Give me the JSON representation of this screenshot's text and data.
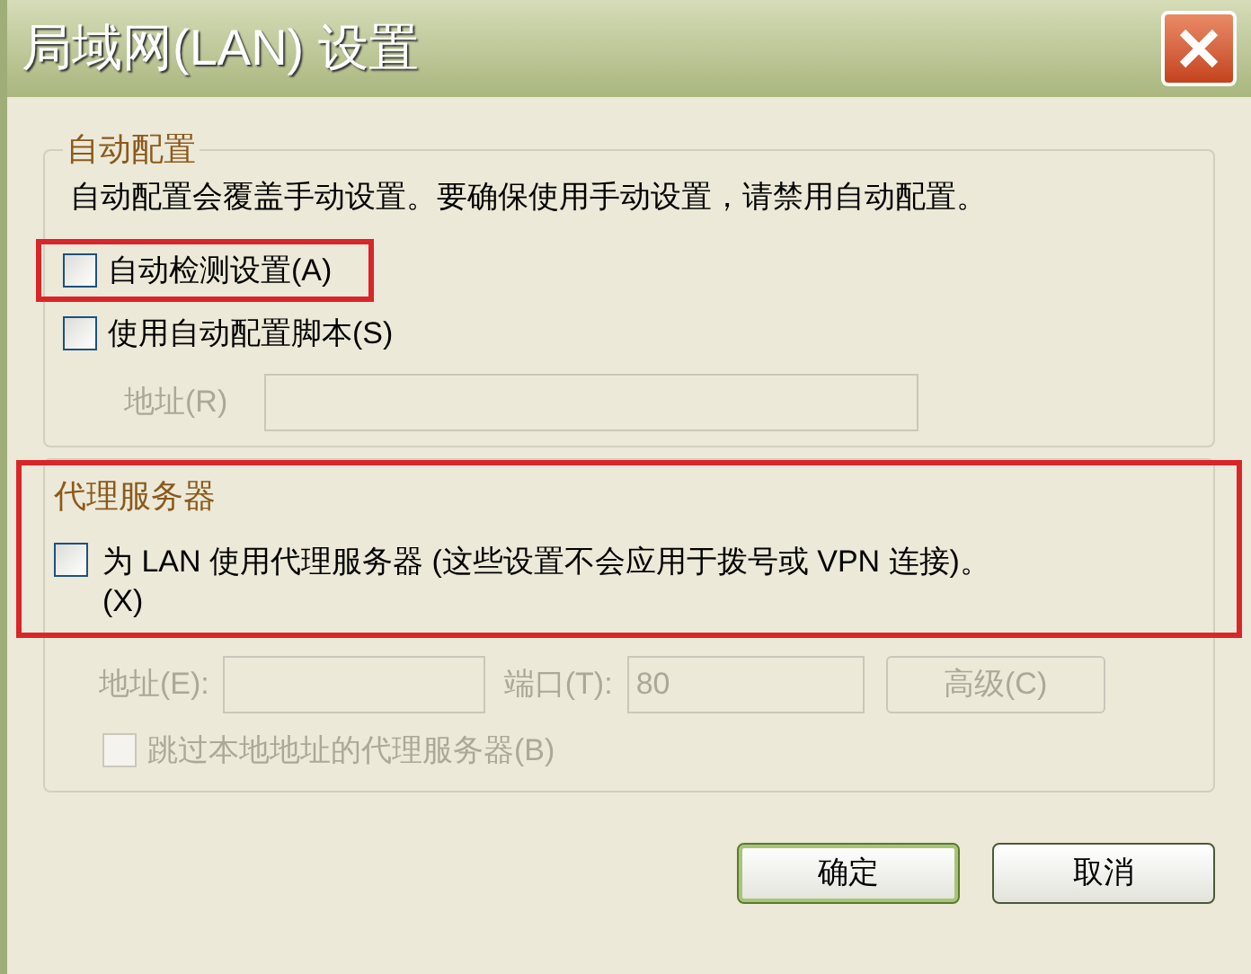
{
  "window": {
    "title": "局域网(LAN) 设置"
  },
  "auto_config": {
    "title": "自动配置",
    "description": "自动配置会覆盖手动设置。要确保使用手动设置，请禁用自动配置。",
    "options": [
      {
        "label": "自动检测设置(A)",
        "checked": false,
        "highlighted": true
      },
      {
        "label": "使用自动配置脚本(S)",
        "checked": false,
        "highlighted": false
      }
    ],
    "address": {
      "label": "地址(R)",
      "disabled": true
    }
  },
  "proxy": {
    "title": "代理服务器",
    "highlighted": true,
    "use_proxy": {
      "label": "为 LAN 使用代理服务器 (这些设置不会应用于拨号或 VPN 连接)。(X)",
      "checked": false
    },
    "disabled": true,
    "address_label": "地址(E):",
    "port_label": "端口(T):",
    "port_value": "80",
    "advanced_button": "高级(C)",
    "bypass": {
      "label": "跳过本地地址的代理服务器(B)",
      "checked": false
    }
  },
  "buttons": [
    {
      "label": "确定",
      "default": true
    },
    {
      "label": "取消",
      "default": false
    }
  ]
}
